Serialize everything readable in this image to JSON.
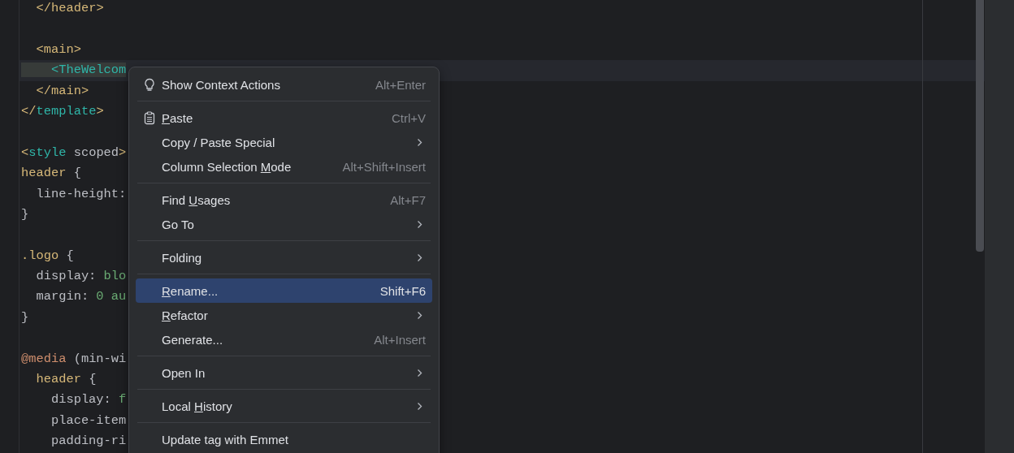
{
  "editor": {
    "lines": [
      {
        "current": false,
        "tokens": [
          {
            "kind": "punct",
            "text": "  </"
          },
          {
            "kind": "tag",
            "text": "header"
          },
          {
            "kind": "punct",
            "text": ">"
          }
        ]
      },
      {
        "current": false
      },
      {
        "current": false,
        "tokens": [
          {
            "kind": "punct",
            "text": "  <"
          },
          {
            "kind": "tag",
            "text": "main"
          },
          {
            "kind": "punct",
            "text": ">"
          }
        ]
      },
      {
        "current": true,
        "tokens": [
          {
            "kind": "component",
            "text": "    <TheWelcom"
          }
        ]
      },
      {
        "current": false,
        "tokens": [
          {
            "kind": "punct",
            "text": "  </"
          },
          {
            "kind": "tag",
            "text": "main"
          },
          {
            "kind": "punct",
            "text": ">"
          }
        ]
      },
      {
        "current": false,
        "tokens": [
          {
            "kind": "punct",
            "text": "</"
          },
          {
            "kind": "component",
            "text": "template"
          },
          {
            "kind": "punct",
            "text": ">"
          }
        ]
      },
      {
        "current": false
      },
      {
        "current": false,
        "tokens": [
          {
            "kind": "punct",
            "text": "<"
          },
          {
            "kind": "component",
            "text": "style"
          },
          {
            "kind": "attr",
            "text": " scoped"
          },
          {
            "kind": "punct",
            "text": ">"
          }
        ]
      },
      {
        "current": false,
        "tokens": [
          {
            "kind": "tag",
            "text": "header"
          },
          {
            "kind": "plain",
            "text": " {"
          }
        ]
      },
      {
        "current": false,
        "tokens": [
          {
            "kind": "plain",
            "text": "  line-height:"
          }
        ]
      },
      {
        "current": false,
        "tokens": [
          {
            "kind": "plain",
            "text": "}"
          }
        ]
      },
      {
        "current": false
      },
      {
        "current": false,
        "tokens": [
          {
            "kind": "tag",
            "text": ".logo"
          },
          {
            "kind": "plain",
            "text": " {"
          }
        ]
      },
      {
        "current": false,
        "tokens": [
          {
            "kind": "plain",
            "text": "  display: "
          },
          {
            "kind": "value",
            "text": "blo"
          }
        ]
      },
      {
        "current": false,
        "tokens": [
          {
            "kind": "plain",
            "text": "  margin: "
          },
          {
            "kind": "value",
            "text": "0 au"
          }
        ]
      },
      {
        "current": false,
        "tokens": [
          {
            "kind": "plain",
            "text": "}"
          }
        ]
      },
      {
        "current": false
      },
      {
        "current": false,
        "tokens": [
          {
            "kind": "at",
            "text": "@media"
          },
          {
            "kind": "plain",
            "text": " (min-wi"
          }
        ]
      },
      {
        "current": false,
        "tokens": [
          {
            "kind": "tag",
            "text": "  header"
          },
          {
            "kind": "plain",
            "text": " {"
          }
        ]
      },
      {
        "current": false,
        "tokens": [
          {
            "kind": "plain",
            "text": "    display: "
          },
          {
            "kind": "value",
            "text": "f"
          }
        ]
      },
      {
        "current": false,
        "tokens": [
          {
            "kind": "plain",
            "text": "    place-item"
          }
        ]
      },
      {
        "current": false,
        "tokens": [
          {
            "kind": "plain",
            "text": "    padding-ri"
          }
        ]
      }
    ]
  },
  "context_menu": {
    "groups": [
      [
        {
          "kind": "action",
          "icon": true,
          "selected": false,
          "label": "Show Context Actions",
          "shortcut": "Alt+Enter"
        }
      ],
      [
        {
          "kind": "action",
          "icon": true,
          "selected": false,
          "key": "P",
          "after": "aste",
          "shortcut": "Ctrl+V"
        },
        {
          "kind": "submenu",
          "selected": false,
          "label": "Copy / Paste Special"
        },
        {
          "kind": "action",
          "selected": false,
          "before": "Column Selection ",
          "key": "M",
          "after": "ode",
          "shortcut": "Alt+Shift+Insert"
        }
      ],
      [
        {
          "kind": "action",
          "selected": false,
          "before": "Find ",
          "key": "U",
          "after": "sages",
          "shortcut": "Alt+F7"
        },
        {
          "kind": "submenu",
          "selected": false,
          "label": "Go To"
        }
      ],
      [
        {
          "kind": "submenu",
          "selected": false,
          "label": "Folding"
        }
      ],
      [
        {
          "kind": "action",
          "selected": true,
          "key": "R",
          "after": "ename...",
          "shortcut": "Shift+F6"
        },
        {
          "kind": "submenu",
          "selected": false,
          "key": "R",
          "after": "efactor"
        },
        {
          "kind": "action",
          "selected": false,
          "label": "Generate...",
          "shortcut": "Alt+Insert"
        }
      ],
      [
        {
          "kind": "submenu",
          "selected": false,
          "label": "Open In"
        }
      ],
      [
        {
          "kind": "submenu",
          "selected": false,
          "before": "Local ",
          "key": "H",
          "after": "istory"
        }
      ],
      [
        {
          "kind": "action",
          "selected": false,
          "label": "Update tag with Emmet"
        }
      ]
    ]
  }
}
